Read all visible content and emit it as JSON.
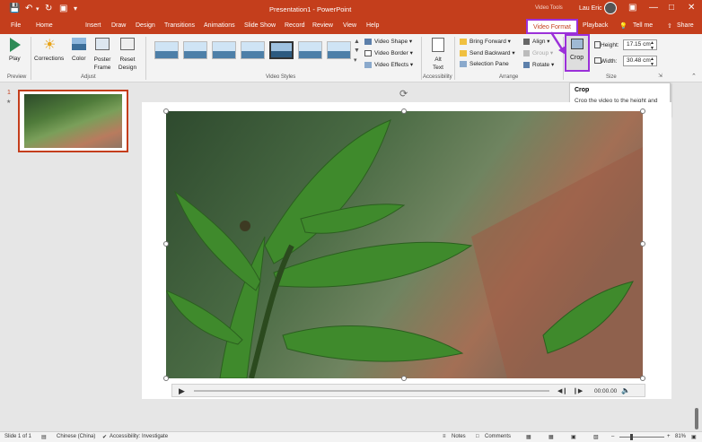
{
  "titlebar": {
    "title": "Presentation1 - PowerPoint",
    "context_label": "Video Tools",
    "user": "Lau Eric"
  },
  "tabs": [
    "File",
    "Home",
    "Insert",
    "Draw",
    "Design",
    "Transitions",
    "Animations",
    "Slide Show",
    "Record",
    "Review",
    "View",
    "Help",
    "Video Format",
    "Playback"
  ],
  "tell_me": "Tell me",
  "share": "Share",
  "ribbon": {
    "preview": {
      "play": "Play",
      "group": "Preview"
    },
    "adjust": {
      "corrections": "Corrections",
      "color": "Color",
      "poster": "Poster Frame",
      "reset": "Reset Design",
      "group": "Adjust"
    },
    "video_styles": {
      "shape": "Video Shape",
      "border": "Video Border",
      "effects": "Video Effects",
      "group": "Video Styles"
    },
    "accessibility": {
      "alt_text": "Alt Text",
      "group": "Accessibility"
    },
    "arrange": {
      "bring_forward": "Bring Forward",
      "send_backward": "Send Backward",
      "selection_pane": "Selection Pane",
      "align": "Align",
      "group_btn": "Group",
      "rotate": "Rotate",
      "group": "Arrange"
    },
    "size": {
      "crop": "Crop",
      "height_label": "Height:",
      "height_value": "17.15 cm",
      "width_label": "Width:",
      "width_value": "30.48 cm",
      "group": "Size"
    }
  },
  "tooltip": {
    "title": "Crop",
    "body": "Crop the video to the height and width you want."
  },
  "slides": {
    "number": "1"
  },
  "player": {
    "time": "00:00.00"
  },
  "status": {
    "slide_of": "Slide 1 of 1",
    "language": "Chinese (China)",
    "accessibility": "Accessibility: Investigate",
    "notes": "Notes",
    "comments": "Comments",
    "zoom": "81%"
  },
  "colors": {
    "accent": "#c43e1c",
    "highlight": "#9b30d9"
  }
}
